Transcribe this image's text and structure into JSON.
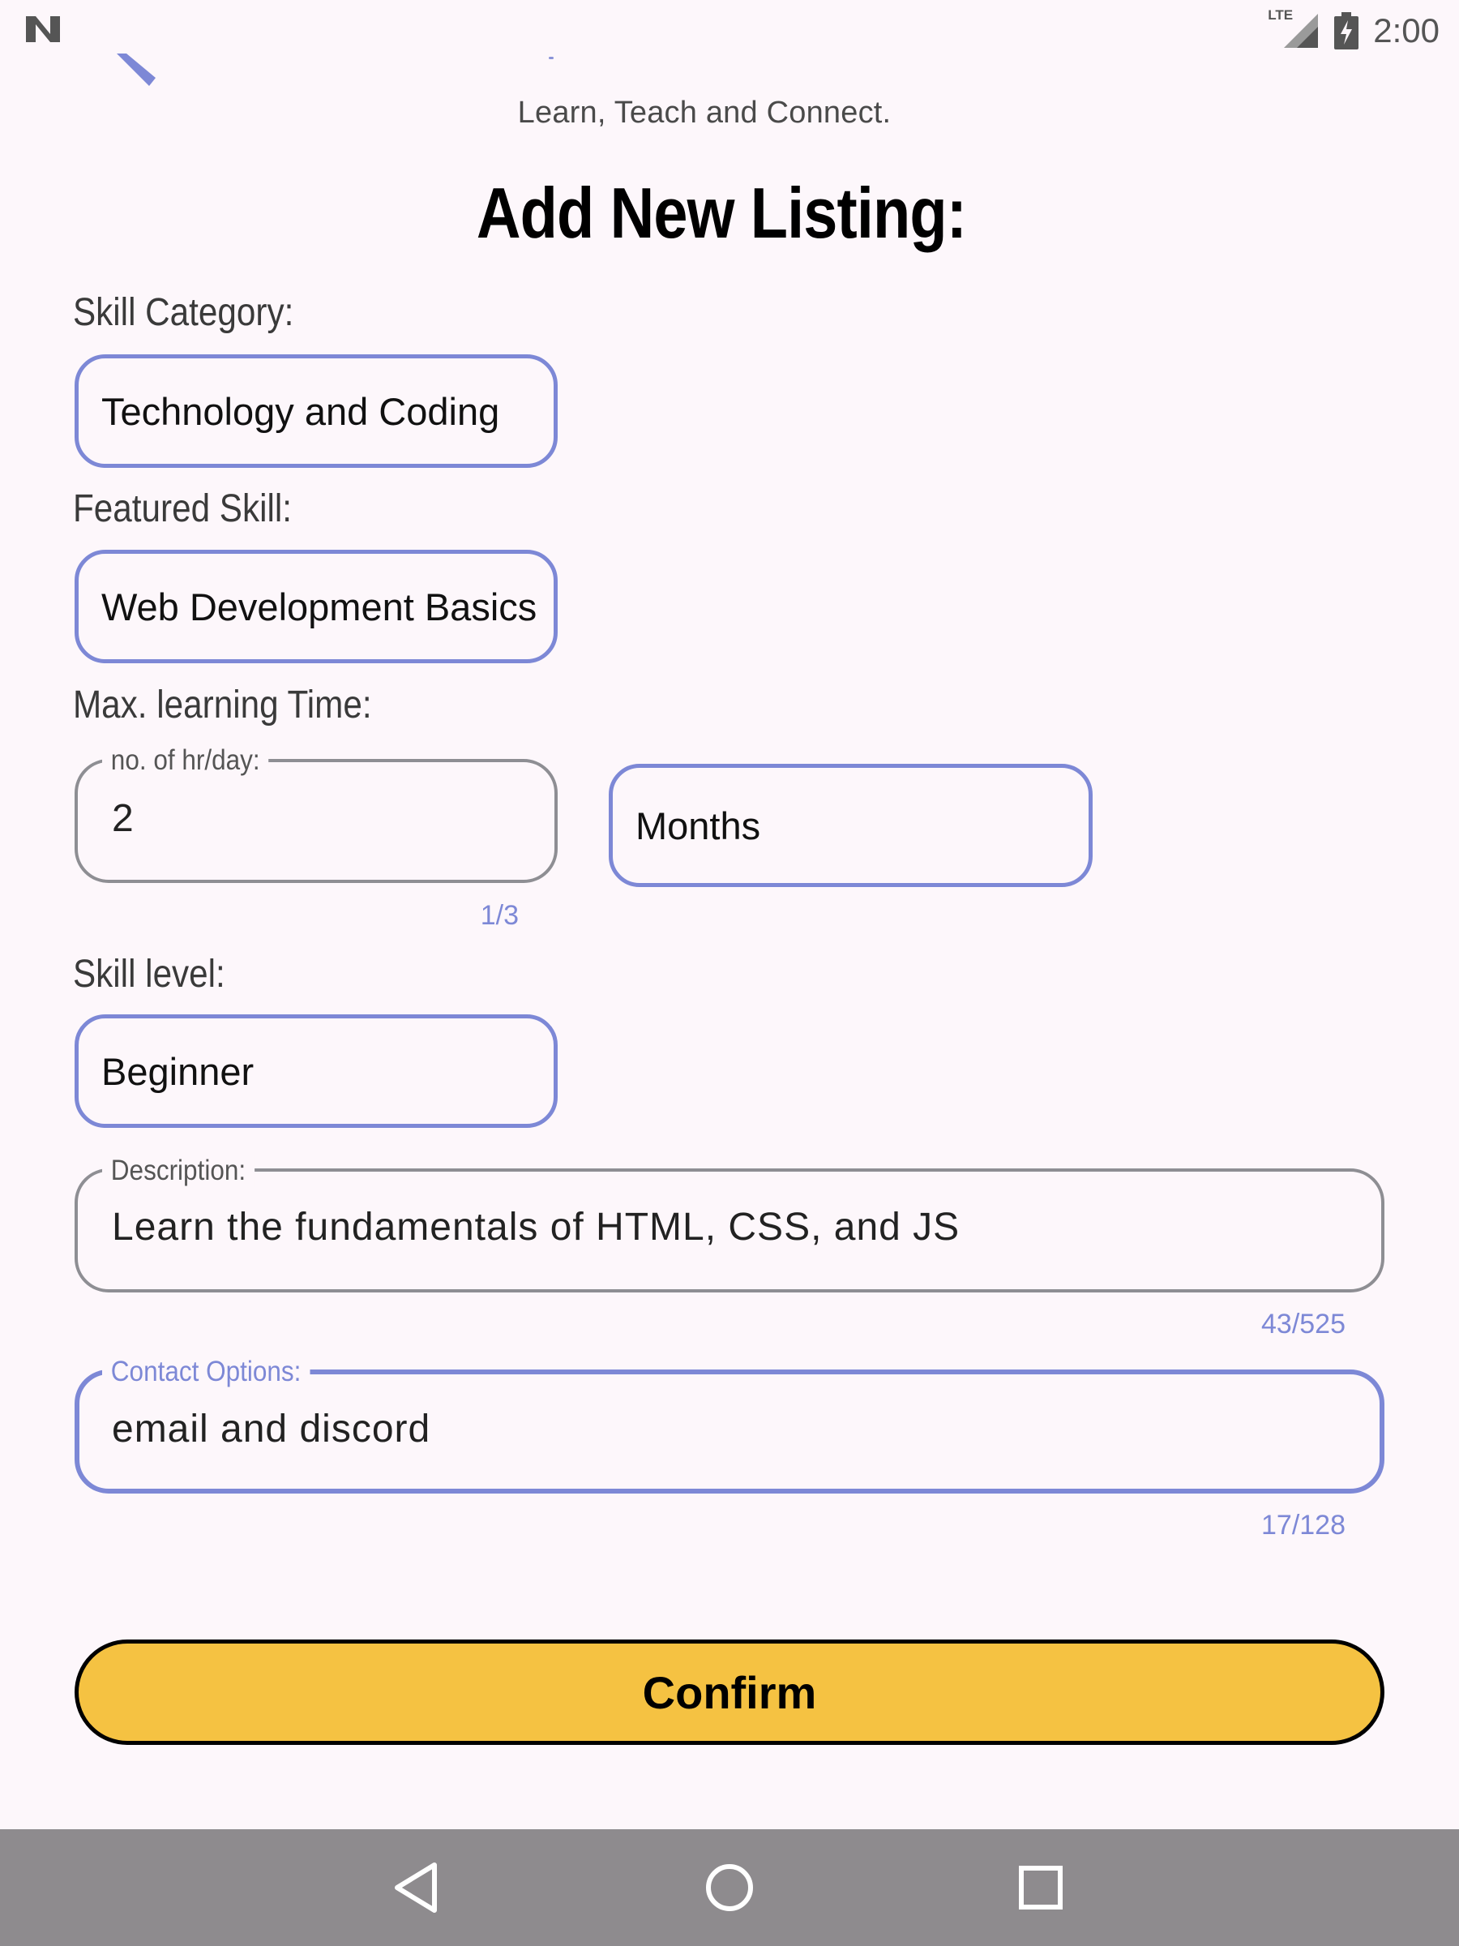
{
  "status_bar": {
    "left_icon": "android-n-icon",
    "network_label": "LTE",
    "time": "2:00"
  },
  "header": {
    "tagline": "Learn, Teach and Connect.",
    "title": "Add New Listing:"
  },
  "form": {
    "skill_category": {
      "label": "Skill Category:",
      "value": "Technology and Coding"
    },
    "featured_skill": {
      "label": "Featured Skill:",
      "value": "Web Development Basics"
    },
    "max_learning_time": {
      "label": "Max. learning Time:",
      "hours_field_label": "no. of hr/day:",
      "hours_value": "2",
      "hours_counter": "1/3",
      "period_value": "Months"
    },
    "skill_level": {
      "label": "Skill level:",
      "value": "Beginner"
    },
    "description": {
      "label": "Description:",
      "value": "Learn the fundamentals of HTML, CSS, and JS",
      "counter": "43/525"
    },
    "contact_options": {
      "label": "Contact Options:",
      "value": "email and discord",
      "counter": "17/128"
    },
    "confirm_label": "Confirm"
  },
  "colors": {
    "background": "#FDF7FB",
    "accent": "#7D88D6",
    "button": "#F5C242",
    "nav_bar": "#8E8B8E"
  },
  "nav_bar": {
    "back": "back-triangle-icon",
    "home": "home-circle-icon",
    "recents": "recents-square-icon"
  }
}
